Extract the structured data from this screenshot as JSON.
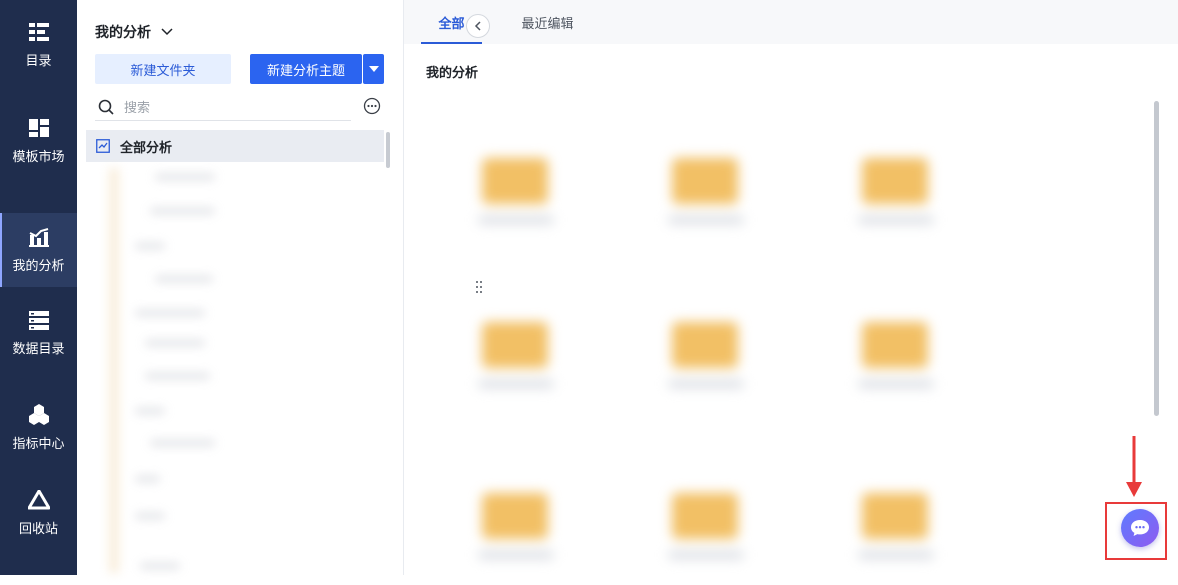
{
  "nav": {
    "items": [
      {
        "label": "目录",
        "icon": "catalog-icon",
        "active": false
      },
      {
        "label": "模板市场",
        "icon": "template-market-icon",
        "active": false
      },
      {
        "label": "我的分析",
        "icon": "my-analysis-icon",
        "active": true
      },
      {
        "label": "数据目录",
        "icon": "data-catalog-icon",
        "active": false
      },
      {
        "label": "指标中心",
        "icon": "metrics-center-icon",
        "active": false
      },
      {
        "label": "回收站",
        "icon": "recycle-bin-icon",
        "active": false
      }
    ]
  },
  "panel": {
    "title": "我的分析",
    "new_folder_label": "新建文件夹",
    "new_topic_label": "新建分析主题",
    "search_placeholder": "搜索",
    "tree_root_label": "全部分析"
  },
  "main": {
    "tabs": [
      {
        "label": "全部",
        "active": true
      },
      {
        "label": "最近编辑",
        "active": false
      }
    ],
    "section_title": "我的分析"
  },
  "colors": {
    "nav_bg": "#1f2d4d",
    "primary": "#2b64f0",
    "highlight_frame": "#e83a3a",
    "folder": "#f2c065"
  }
}
